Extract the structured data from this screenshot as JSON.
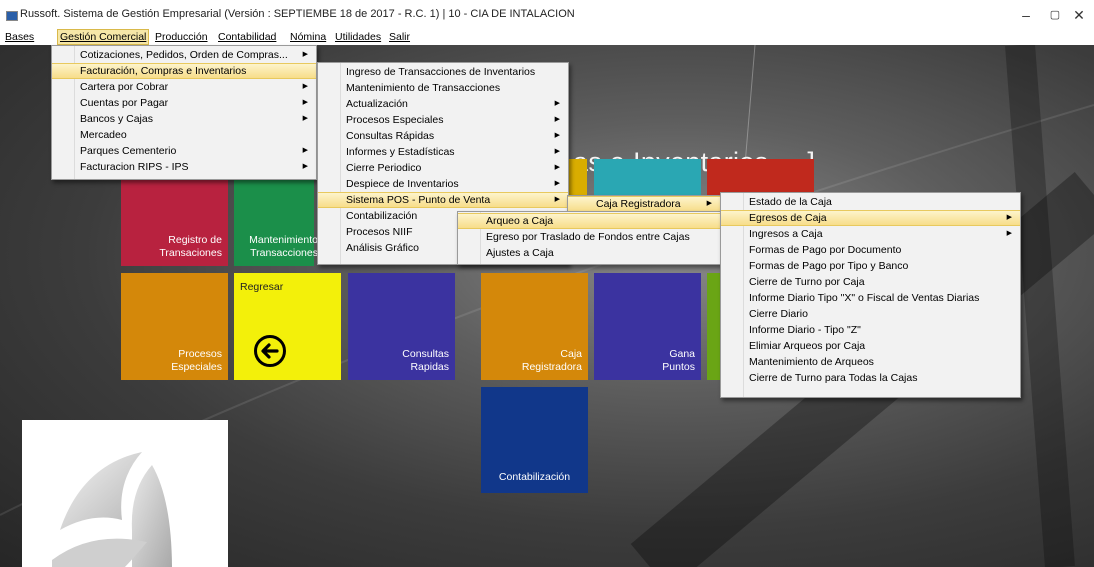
{
  "window": {
    "title": "Russoft. Sistema de Gestión Empresarial (Versión : SEPTIEMBE 18 de 2017 - R.C. 1) | 10 - CIA DE INTALACION",
    "controls": {
      "minimize": "–",
      "maximize": "▢",
      "close": "✕"
    }
  },
  "menubar": [
    "Bases",
    "Gestión Comercial",
    "Producción",
    "Contabilidad",
    "Nómina",
    "Utilidades",
    "Salir"
  ],
  "main": {
    "heading": "as e Inventarios ... ]"
  },
  "tiles": {
    "registro": "Registro de Transaciones",
    "mantenimiento": "Mantenimiento Transacciones",
    "regresar": "Regresar",
    "procesos": "Procesos Especiales",
    "consultas": "Consultas Rapidas",
    "caja": "Caja Registradora",
    "gana": "Gana Puntos",
    "contabilizacion": "Contabilización"
  },
  "colors": {
    "red": "#b8223f",
    "green": "#1b8f4a",
    "orange": "#d4880a",
    "yellow": "#f3f00a",
    "purple": "#3b33a0",
    "teal": "#2aa7b3",
    "darkred": "#c0291d",
    "navy": "#11378a",
    "lime": "#6aa515",
    "menu_highlight": "#f7dd8a"
  },
  "menus": {
    "gestion_comercial": [
      {
        "label": "Cotizaciones, Pedidos, Orden de Compras...",
        "sub": true
      },
      {
        "label": "Facturación, Compras e Inventarios",
        "sub": false
      },
      {
        "label": "Cartera por Cobrar",
        "sub": true
      },
      {
        "label": "Cuentas por Pagar",
        "sub": true
      },
      {
        "label": "Bancos y Cajas",
        "sub": true
      },
      {
        "label": "Mercadeo",
        "sub": false
      },
      {
        "label": "Parques Cementerio",
        "sub": true
      },
      {
        "label": "Facturacion RIPS - IPS",
        "sub": true
      }
    ],
    "facturacion": [
      {
        "label": "Ingreso de Transacciones de Inventarios",
        "sub": false
      },
      {
        "label": "Mantenimiento de Transacciones",
        "sub": false
      },
      {
        "label": "Actualización",
        "sub": true
      },
      {
        "label": "Procesos Especiales",
        "sub": true
      },
      {
        "label": "Consultas Rápidas",
        "sub": true
      },
      {
        "label": "Informes y Estadísticas",
        "sub": true
      },
      {
        "label": "Cierre Periodico",
        "sub": true
      },
      {
        "label": "Despiece de Inventarios",
        "sub": true
      },
      {
        "label": "Sistema POS - Punto de Venta",
        "sub": true
      },
      {
        "label": "Contabilización",
        "sub": true
      },
      {
        "label": "Procesos NIIF",
        "sub": true
      },
      {
        "label": "Análisis Gráfico",
        "sub": true
      }
    ],
    "pos": [
      {
        "label": "Caja Registradora",
        "sub": true
      }
    ],
    "arqueo": [
      {
        "label": "Arqueo a Caja",
        "sub": false
      },
      {
        "label": "Egreso por Traslado de Fondos entre Cajas",
        "sub": false
      },
      {
        "label": "Ajustes a Caja",
        "sub": false
      }
    ],
    "caja": [
      {
        "label": "Estado de la Caja",
        "sub": false
      },
      {
        "label": "Egresos de Caja",
        "sub": true
      },
      {
        "label": "Ingresos a Caja",
        "sub": true
      },
      {
        "label": "Formas de Pago por Documento",
        "sub": false
      },
      {
        "label": "Formas de Pago por Tipo y Banco",
        "sub": false
      },
      {
        "label": "Cierre de Turno por Caja",
        "sub": false
      },
      {
        "label": "Informe Diario Tipo \"X\" o Fiscal de Ventas Diarias",
        "sub": false
      },
      {
        "label": "Cierre Diario",
        "sub": false
      },
      {
        "label": "Informe Diario - Tipo \"Z\"",
        "sub": false
      },
      {
        "label": "Elimiar Arqueos por Caja",
        "sub": false
      },
      {
        "label": "Mantenimiento de Arqueos",
        "sub": false
      },
      {
        "label": "Cierre de Turno para Todas la Cajas",
        "sub": false
      }
    ]
  }
}
